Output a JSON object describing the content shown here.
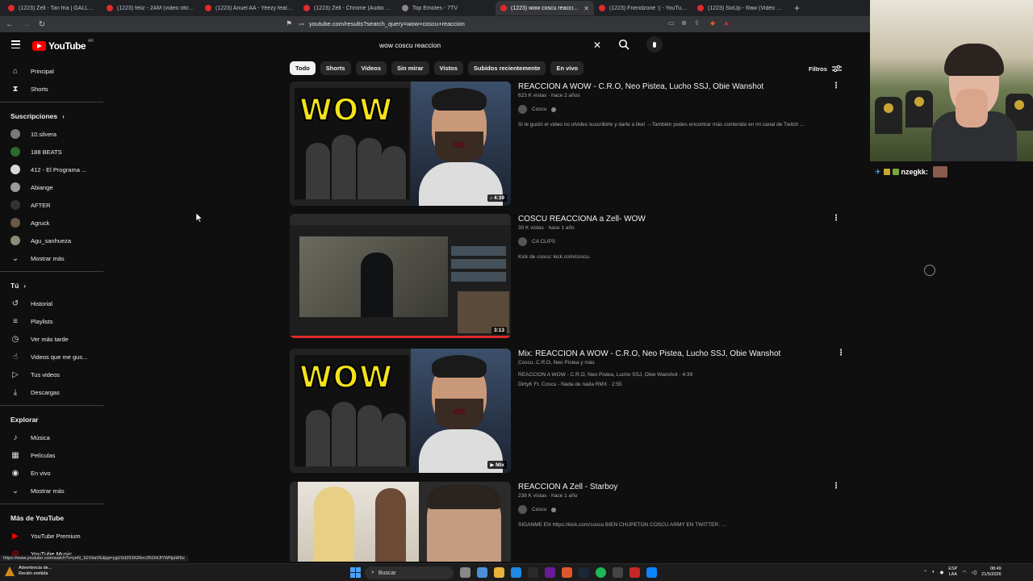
{
  "browser": {
    "tabs": [
      {
        "label": "(1223) Zell - Tan fria | GALLERY SESSION",
        "active": false
      },
      {
        "label": "(1223) feliz - 2AM (video oficial) - YouTube",
        "active": false
      },
      {
        "label": "(1223) Anuel AA - Yeezy feat. Ñengo",
        "active": false
      },
      {
        "label": "(1223) Zell - Chrome (Audio Oficial)",
        "active": false
      },
      {
        "label": "Top Emotes - 7TV",
        "active": false
      },
      {
        "label": "(1223) wow coscu reaccion - YouTube",
        "active": true
      },
      {
        "label": "(1223) Friendzone :( - YouTube",
        "active": false
      },
      {
        "label": "(1223) SixUp - Raw (Video Oficial) - YouTube",
        "active": false
      }
    ],
    "url": "youtube.com/results?search_query=wow+coscu+reaccion",
    "status_url": "https://www.youtube.com/watch?v=yeN_1EVdaVE&pp=ygUSd293IGNvc2N1IHJlYWNjaW9u"
  },
  "youtube": {
    "logo_text": "YouTube",
    "logo_country": "AR",
    "search_query": "wow coscu reaccion"
  },
  "sidebar": {
    "main": [
      {
        "label": "Principal",
        "icon": "home-icon"
      },
      {
        "label": "Shorts",
        "icon": "shorts-icon"
      }
    ],
    "subs_heading": "Suscripciones",
    "subscriptions": [
      {
        "label": "10.silvera"
      },
      {
        "label": "188 BEATS"
      },
      {
        "label": "412 - El Programa ..."
      },
      {
        "label": "Abiange"
      },
      {
        "label": "AFTER"
      },
      {
        "label": "Agruck"
      },
      {
        "label": "Agu_sanhueza"
      }
    ],
    "subs_more": "Mostrar más",
    "you_heading": "Tú",
    "you": [
      {
        "label": "Historial",
        "icon": "history-icon"
      },
      {
        "label": "Playlists",
        "icon": "playlist-icon"
      },
      {
        "label": "Ver más tarde",
        "icon": "clock-icon"
      },
      {
        "label": "Videos que me gus...",
        "icon": "like-icon"
      },
      {
        "label": "Tus videos",
        "icon": "video-icon"
      },
      {
        "label": "Descargas",
        "icon": "download-icon"
      }
    ],
    "explore_heading": "Explorar",
    "explore": [
      {
        "label": "Música",
        "icon": "music-icon"
      },
      {
        "label": "Películas",
        "icon": "film-icon"
      },
      {
        "label": "En vivo",
        "icon": "live-icon"
      }
    ],
    "explore_more": "Mostrar más",
    "more_heading": "Más de YouTube",
    "more": [
      {
        "label": "YouTube Premium",
        "icon": "yt-premium-icon"
      },
      {
        "label": "YouTube Music",
        "icon": "yt-music-icon"
      }
    ]
  },
  "filters": {
    "chips": [
      "Todo",
      "Shorts",
      "Videos",
      "Sin mirar",
      "Vistos",
      "Subidos recientemente",
      "En vivo"
    ],
    "selected": "Todo",
    "filters_label": "Filtros"
  },
  "results": [
    {
      "title": "REACCION A WOW - C.R.O, Neo Pistea, Lucho SSJ, Obie Wanshot",
      "meta": "623 K vistas · hace 2 años",
      "channel": "Coscu",
      "description": "Si te gustó el video no olvides suscribirte y darle a like! →También podes encontrar más contenido en mi canal de Twitch ...",
      "badge": "4:39",
      "thumb_text": "WOW"
    },
    {
      "title": "COSCU REACCIONA a Zell- WOW",
      "meta": "30 K vistas · hace 1 año",
      "channel": "CA CLIPS",
      "description": "Kick de coscu: kick.com/coscu.",
      "badge": "3:13"
    },
    {
      "title": "Mix: REACCION A WOW - C.R.O, Neo Pistea, Lucho SSJ, Obie Wanshot",
      "meta": "Coscu, C.R.O, Neo Pistea y más",
      "track1": "REACCION A WOW - C.R.O, Neo Pistea, Lucho SSJ, Obie Wanshot · 4:39",
      "track2": "DirtyK Ft. Coscu - Nada de nada RMX · 2:55",
      "badge": "Mix",
      "thumb_text": "WOW"
    },
    {
      "title": "REACCION A Zell - Starboy",
      "meta": "238 K vistas · hace 1 año",
      "channel": "Coscu",
      "description": "SIGANME EN https://kick.com/coscu BIEN CHUPETON COSCU ARMY EN TWITTER: ..."
    }
  ],
  "stream_overlay": {
    "chat_user": "nzegkk:"
  },
  "taskbar": {
    "warning_title": "Advertencia de...",
    "warning_sub": "Recién emitida",
    "search_label": "Buscar",
    "lang1": "ESP",
    "lang2": "LAA",
    "time": "08:49",
    "date": "21/5/2026"
  }
}
